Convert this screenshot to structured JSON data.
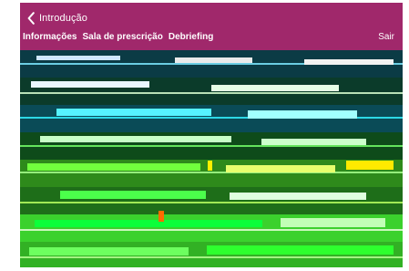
{
  "header": {
    "back_label": "Introdução",
    "tabs": [
      {
        "label": "Informações"
      },
      {
        "label": "Sala de prescrição"
      },
      {
        "label": "Debriefing"
      }
    ],
    "logout_label": "Sair",
    "colors": {
      "brand": "#a0286b",
      "text": "#ffffff"
    },
    "icons": {
      "back": "chevron-left-icon"
    }
  }
}
